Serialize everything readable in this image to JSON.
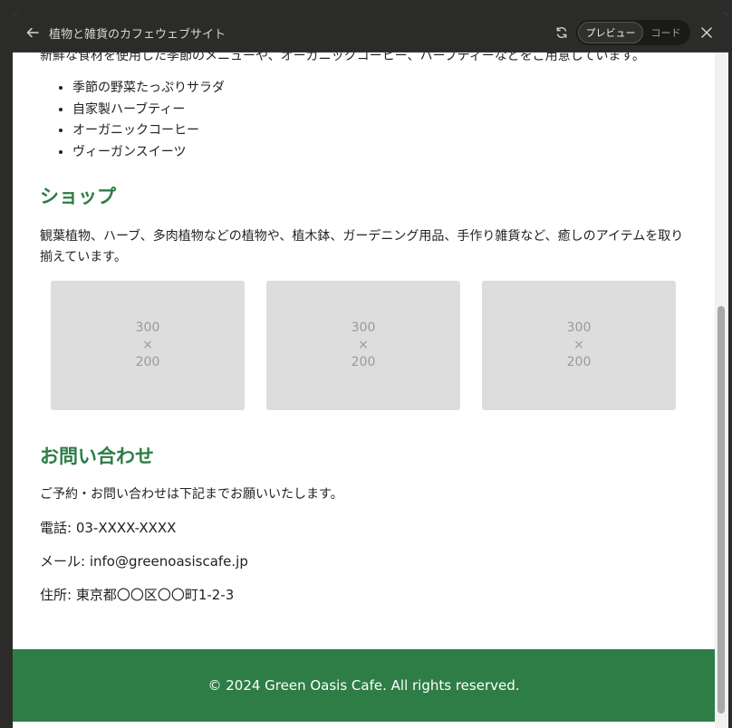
{
  "window": {
    "title": "植物と雑貨のカフェウェブサイト",
    "toggle_preview": "プレビュー",
    "toggle_code": "コード"
  },
  "page": {
    "intro": "新鮮な食材を使用した季節のメニューや、オーガニックコーヒー、ハーブティーなどをご用意しています。",
    "menu_items": [
      "季節の野菜たっぷりサラダ",
      "自家製ハーブティー",
      "オーガニックコーヒー",
      "ヴィーガンスイーツ"
    ],
    "shop": {
      "title": "ショップ",
      "description": "観葉植物、ハーブ、多肉植物などの植物や、植木鉢、ガーデニング用品、手作り雑貨など、癒しのアイテムを取り揃えています。",
      "placeholders": [
        {
          "w": "300",
          "x": "×",
          "h": "200"
        },
        {
          "w": "300",
          "x": "×",
          "h": "200"
        },
        {
          "w": "300",
          "x": "×",
          "h": "200"
        }
      ]
    },
    "contact": {
      "title": "お問い合わせ",
      "lead": "ご予約・お問い合わせは下記までお願いいたします。",
      "phone": "電話: 03-XXXX-XXXX",
      "email": "メール: info@greenoasiscafe.jp",
      "address": "住所: 東京都〇〇区〇〇町1-2-3"
    },
    "footer": "© 2024 Green Oasis Cafe. All rights reserved."
  },
  "icons": {
    "back": "arrow-left-icon",
    "refresh": "refresh-icon",
    "close": "close-icon"
  },
  "colors": {
    "accent": "#2e7d46",
    "titlebar": "#2b2b29",
    "placeholder": "#dddddd"
  }
}
